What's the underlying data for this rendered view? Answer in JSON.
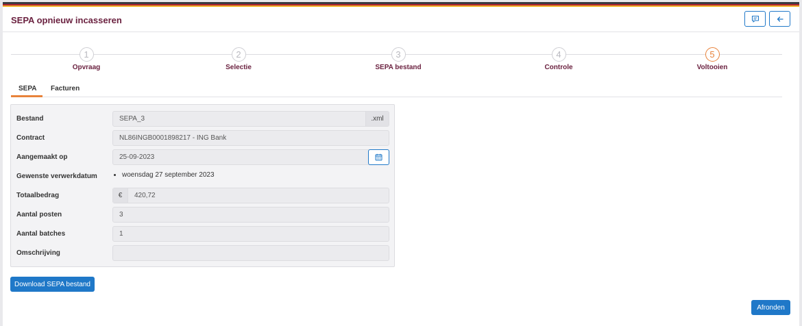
{
  "header": {
    "title": "SEPA opnieuw incasseren",
    "comment_icon": "comment-icon",
    "back_icon": "arrow-left-icon"
  },
  "steps": [
    {
      "number": "1",
      "label": "Opvraag",
      "active": false
    },
    {
      "number": "2",
      "label": "Selectie",
      "active": false
    },
    {
      "number": "3",
      "label": "SEPA bestand",
      "active": false
    },
    {
      "number": "4",
      "label": "Controle",
      "active": false
    },
    {
      "number": "5",
      "label": "Voltooien",
      "active": true
    }
  ],
  "tabs": [
    {
      "label": "SEPA",
      "selected": true
    },
    {
      "label": "Facturen",
      "selected": false
    }
  ],
  "form": {
    "bestand": {
      "label": "Bestand",
      "value": "SEPA_3",
      "suffix": ".xml"
    },
    "contract": {
      "label": "Contract",
      "value": "NL86INGB0001898217 - ING Bank"
    },
    "aangemaakt": {
      "label": "Aangemaakt op",
      "value": "25-09-2023",
      "icon": "calendar-icon"
    },
    "verwerkdatum": {
      "label": "Gewenste verwerkdatum",
      "items": [
        "woensdag 27 september 2023"
      ]
    },
    "totaalbedrag": {
      "label": "Totaalbedrag",
      "prefix": "€",
      "value": "420,72"
    },
    "posten": {
      "label": "Aantal posten",
      "value": "3"
    },
    "batches": {
      "label": "Aantal batches",
      "value": "1"
    },
    "omschrijving": {
      "label": "Omschrijving",
      "value": ""
    }
  },
  "actions": {
    "download_label": "Download SEPA bestand",
    "finish_label": "Afronden"
  },
  "colors": {
    "accent": "#1f78c8",
    "title": "#6b2240",
    "active_step": "#e8823a"
  }
}
